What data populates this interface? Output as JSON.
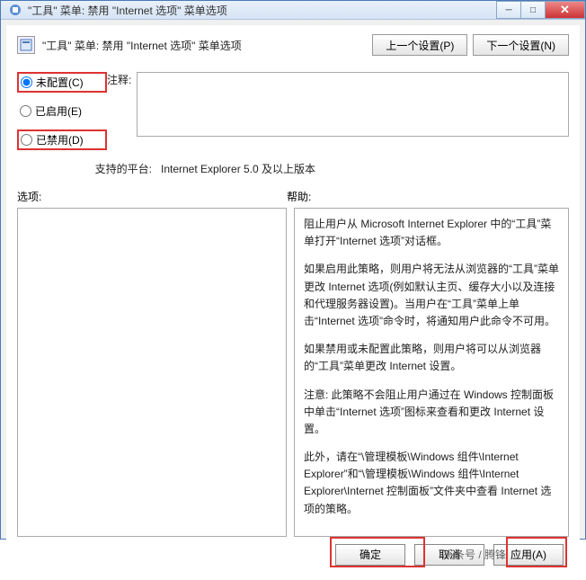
{
  "window": {
    "title": "\"工具\" 菜单: 禁用 \"Internet 选项\" 菜单选项"
  },
  "header": {
    "title": "\"工具\" 菜单: 禁用 \"Internet 选项\" 菜单选项",
    "prev": "上一个设置(P)",
    "next": "下一个设置(N)"
  },
  "radios": {
    "not_configured": "未配置(C)",
    "enabled": "已启用(E)",
    "disabled": "已禁用(D)"
  },
  "labels": {
    "comment": "注释:",
    "platform": "支持的平台:",
    "options": "选项:",
    "help": "帮助:"
  },
  "platform_value": "Internet Explorer 5.0 及以上版本",
  "help": {
    "p1": "阻止用户从 Microsoft Internet Explorer 中的“工具”菜单打开“Internet 选项”对话框。",
    "p2": "如果启用此策略，则用户将无法从浏览器的“工具”菜单更改 Internet 选项(例如默认主页、缓存大小以及连接和代理服务器设置)。当用户在“工具”菜单上单击“Internet 选项”命令时，将通知用户此命令不可用。",
    "p3": "如果禁用或未配置此策略，则用户将可以从浏览器的“工具”菜单更改 Internet 设置。",
    "p4": "注意: 此策略不会阻止用户通过在 Windows 控制面板中单击“Internet 选项”图标来查看和更改 Internet 设置。",
    "p5": "此外，请在“\\管理模板\\Windows 组件\\Internet Explorer”和“\\管理模板\\Windows 组件\\Internet Explorer\\Internet 控制面板”文件夹中查看 Internet 选项的策略。"
  },
  "footer": {
    "ok": "确定",
    "cancel": "取消",
    "apply": "应用(A)"
  },
  "watermark": "头条号 / 腾锋"
}
